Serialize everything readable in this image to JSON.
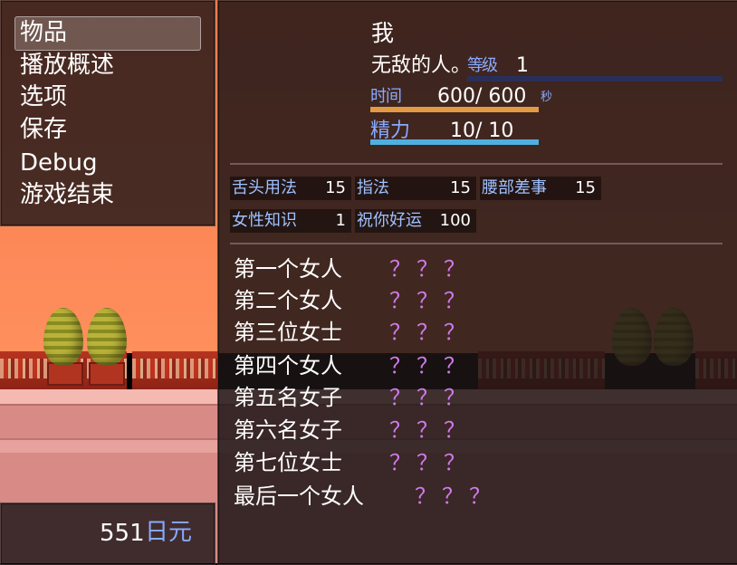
{
  "menu": {
    "items": [
      "物品",
      "播放概述",
      "选项",
      "保存",
      "Debug",
      "游戏结束"
    ],
    "selected_index": 0
  },
  "gold": {
    "value": "551",
    "unit": "日元"
  },
  "actor": {
    "name": "我",
    "nickname": "无敌的人。",
    "level_label": "等级",
    "level": "1",
    "time_label": "时间",
    "time_value": "600/ 600",
    "time_unit": "秒",
    "energy_label": "精力",
    "energy_value": "10/  10",
    "level_bar_color": "#2a2f5a",
    "time_bar_color": "#e39a44",
    "energy_bar_color": "#4fb0e0"
  },
  "skills": [
    {
      "name": "舌头用法",
      "value": "15"
    },
    {
      "name": "指法",
      "value": "15"
    },
    {
      "name": "腰部差事",
      "value": "15"
    },
    {
      "name": "女性知识",
      "value": "1"
    },
    {
      "name": "祝你好运",
      "value": "100"
    }
  ],
  "women": [
    {
      "name": "第一个女人",
      "status": "？？？"
    },
    {
      "name": "第二个女人",
      "status": "？？？"
    },
    {
      "name": "第三位女士",
      "status": "？？？"
    },
    {
      "name": "第四个女人",
      "status": "？？？"
    },
    {
      "name": "第五名女子",
      "status": "？？？"
    },
    {
      "name": "第六名女子",
      "status": "？？？"
    },
    {
      "name": "第七位女士",
      "status": "？？？"
    },
    {
      "name": "最后一个女人",
      "status": "？？？"
    }
  ],
  "colors": {
    "accent": "#88aaff",
    "unknown_status": "#d07ae8"
  }
}
